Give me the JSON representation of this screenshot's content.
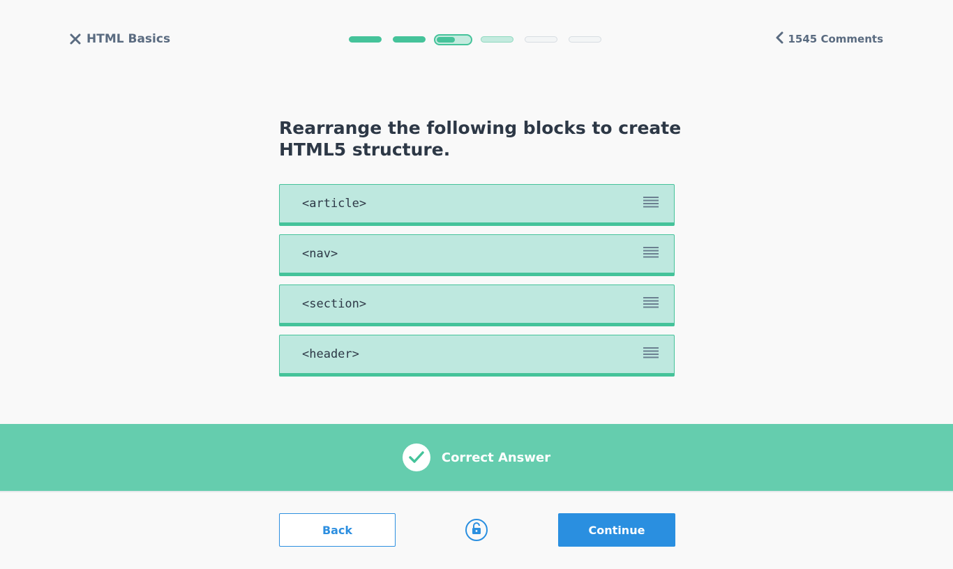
{
  "header": {
    "lesson_title": "HTML Basics",
    "comments_label": "1545 Comments",
    "progress": {
      "total_steps": 6,
      "completed_steps": 2,
      "current_step": 3,
      "current_step_fill": 0.5
    }
  },
  "question": {
    "prompt": "Rearrange the following blocks to create HTML5 structure."
  },
  "blocks": [
    {
      "code": "<article>",
      "icon": "drag-handle-icon"
    },
    {
      "code": "<nav>",
      "icon": "drag-handle-icon"
    },
    {
      "code": "<section>",
      "icon": "drag-handle-icon"
    },
    {
      "code": "<header>",
      "icon": "drag-handle-icon"
    }
  ],
  "feedback": {
    "status_text": "Correct Answer",
    "icon": "check-icon"
  },
  "footer": {
    "back_label": "Back",
    "continue_label": "Continue",
    "unlock_icon": "unlock-icon"
  },
  "colors": {
    "accent_green": "#45c39a",
    "feedback_green": "#65cdae",
    "block_bg": "#bee8df",
    "primary_blue": "#2a8fe0",
    "text_dark": "#2d3846",
    "text_muted": "#5a6b80"
  }
}
